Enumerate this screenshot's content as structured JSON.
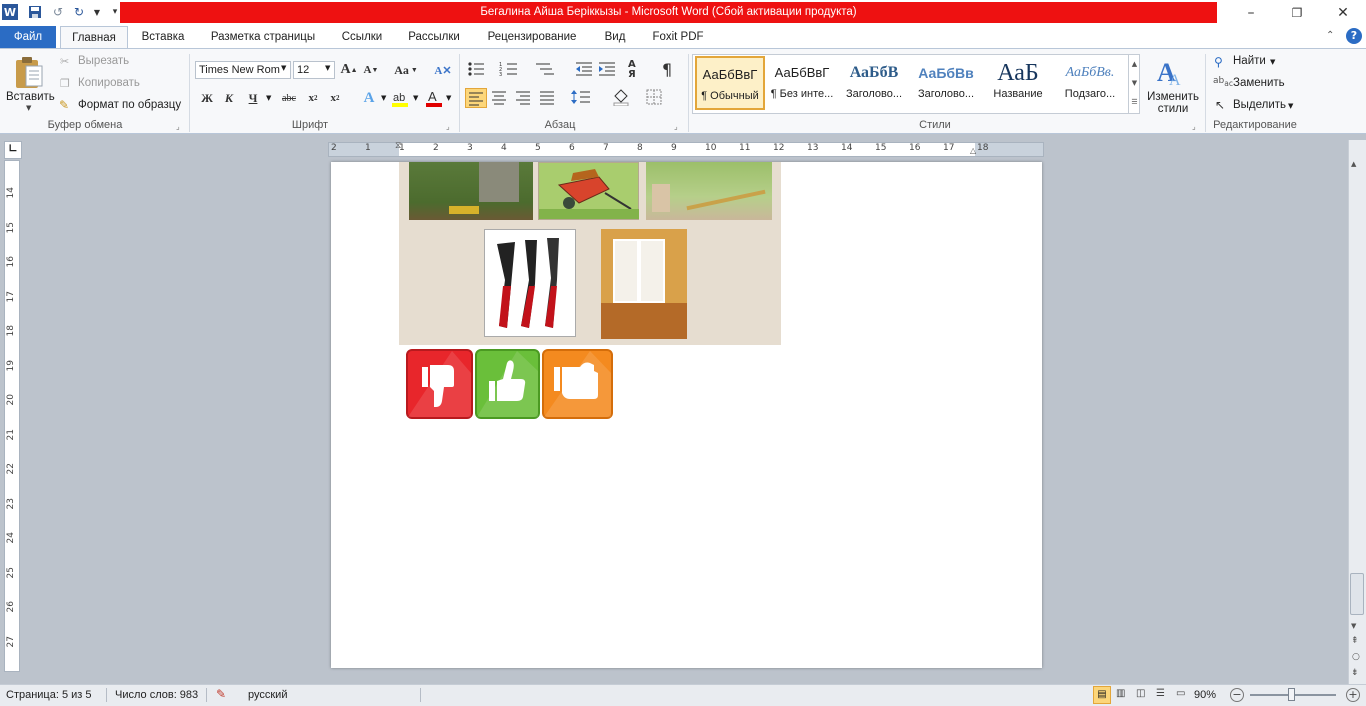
{
  "window": {
    "title": "Бегалина Айша Беріккызы  -  Microsoft Word (Сбой активации продукта)",
    "accent_color": "#2b6cc4",
    "title_bar_color": "#ee1111"
  },
  "quick_access": [
    {
      "name": "word-logo-icon"
    },
    {
      "name": "save-icon"
    },
    {
      "name": "undo-icon"
    },
    {
      "name": "redo-icon"
    },
    {
      "name": "customize-qat-icon"
    }
  ],
  "window_controls": {
    "minimize": "–",
    "restore": "❐",
    "close": "✕"
  },
  "tabs": [
    {
      "label": "Файл",
      "active": false
    },
    {
      "label": "Главная",
      "active": true
    },
    {
      "label": "Вставка"
    },
    {
      "label": "Разметка страницы"
    },
    {
      "label": "Ссылки"
    },
    {
      "label": "Рассылки"
    },
    {
      "label": "Рецензирование"
    },
    {
      "label": "Вид"
    },
    {
      "label": "Foxit PDF"
    }
  ],
  "clipboard": {
    "paste": "Вставить",
    "cut": "Вырезать",
    "copy": "Копировать",
    "format_painter": "Формат по образцу",
    "label": "Буфер обмена"
  },
  "font": {
    "family": "Times New Rom",
    "size": "12",
    "label": "Шрифт",
    "bold": "Ж",
    "italic": "К",
    "underline": "Ч",
    "strike": "abc",
    "grow": "A",
    "shrink": "A",
    "case": "Aa"
  },
  "paragraph": {
    "label": "Абзац",
    "pilcrow": "¶"
  },
  "styles": {
    "label": "Стили",
    "items": [
      {
        "sample": "АаБбВвГ",
        "name": "¶ Обычный",
        "active": true
      },
      {
        "sample": "АаБбВвГ",
        "name": "¶ Без инте..."
      },
      {
        "sample": "АаБбВ",
        "name": "Заголово..."
      },
      {
        "sample": "АаБбВв",
        "name": "Заголово..."
      },
      {
        "sample": "АаБ",
        "name": "Название"
      },
      {
        "sample": "АаБбВв.",
        "name": "Подзаго..."
      }
    ],
    "change": "Изменить стили"
  },
  "editing": {
    "label": "Редактирование",
    "find": "Найти",
    "replace": "Заменить",
    "select": "Выделить"
  },
  "ruler": {
    "h_ticks": [
      "2",
      "1",
      "1",
      "2",
      "3",
      "4",
      "5",
      "6",
      "7",
      "8",
      "9",
      "10",
      "11",
      "12",
      "13",
      "14",
      "15",
      "16",
      "17",
      "18"
    ],
    "v_ticks": [
      "14",
      "15",
      "16",
      "17",
      "18",
      "19",
      "20",
      "21",
      "22",
      "23",
      "24",
      "25",
      "26",
      "27"
    ]
  },
  "document": {
    "images": [
      {
        "name": "photo-collage",
        "desc": "collage"
      },
      {
        "name": "thumbs-down-icon",
        "color": "#e8262b"
      },
      {
        "name": "thumbs-up-icon",
        "color": "#6abf3a"
      },
      {
        "name": "thumbs-side-icon",
        "color": "#f48a1f"
      }
    ]
  },
  "status": {
    "page": "Страница: 5 из 5",
    "words": "Число слов: 983",
    "language": "русский",
    "zoom": "90%",
    "zoom_fraction": 0.48
  }
}
